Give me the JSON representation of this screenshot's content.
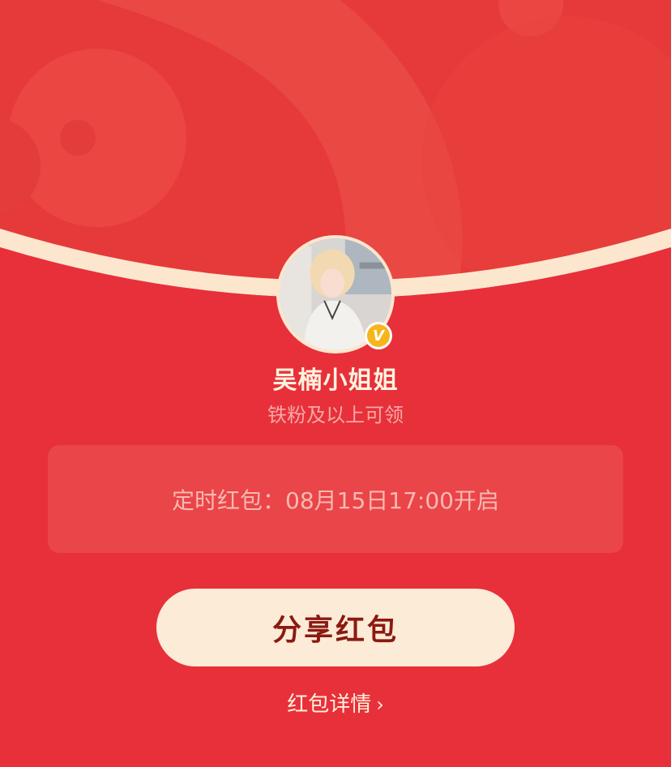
{
  "colors": {
    "background": "#E7303A",
    "cream": "#FCE6CE",
    "button_bg": "#FCEBD6",
    "button_text": "#8A1A12",
    "badge": "#F6B51B"
  },
  "user": {
    "name": "吴楠小姐姐",
    "requirement": "铁粉及以上可领",
    "verified_badge": "V"
  },
  "timer": {
    "text": "定时红包：08月15日17:00开启"
  },
  "share_button": {
    "label": "分享红包"
  },
  "details_link": {
    "label": "红包详情",
    "chevron": "›"
  },
  "icons": {
    "avatar": "avatar-photo",
    "badge": "verified-v-icon",
    "chevron": "chevron-right-icon"
  }
}
